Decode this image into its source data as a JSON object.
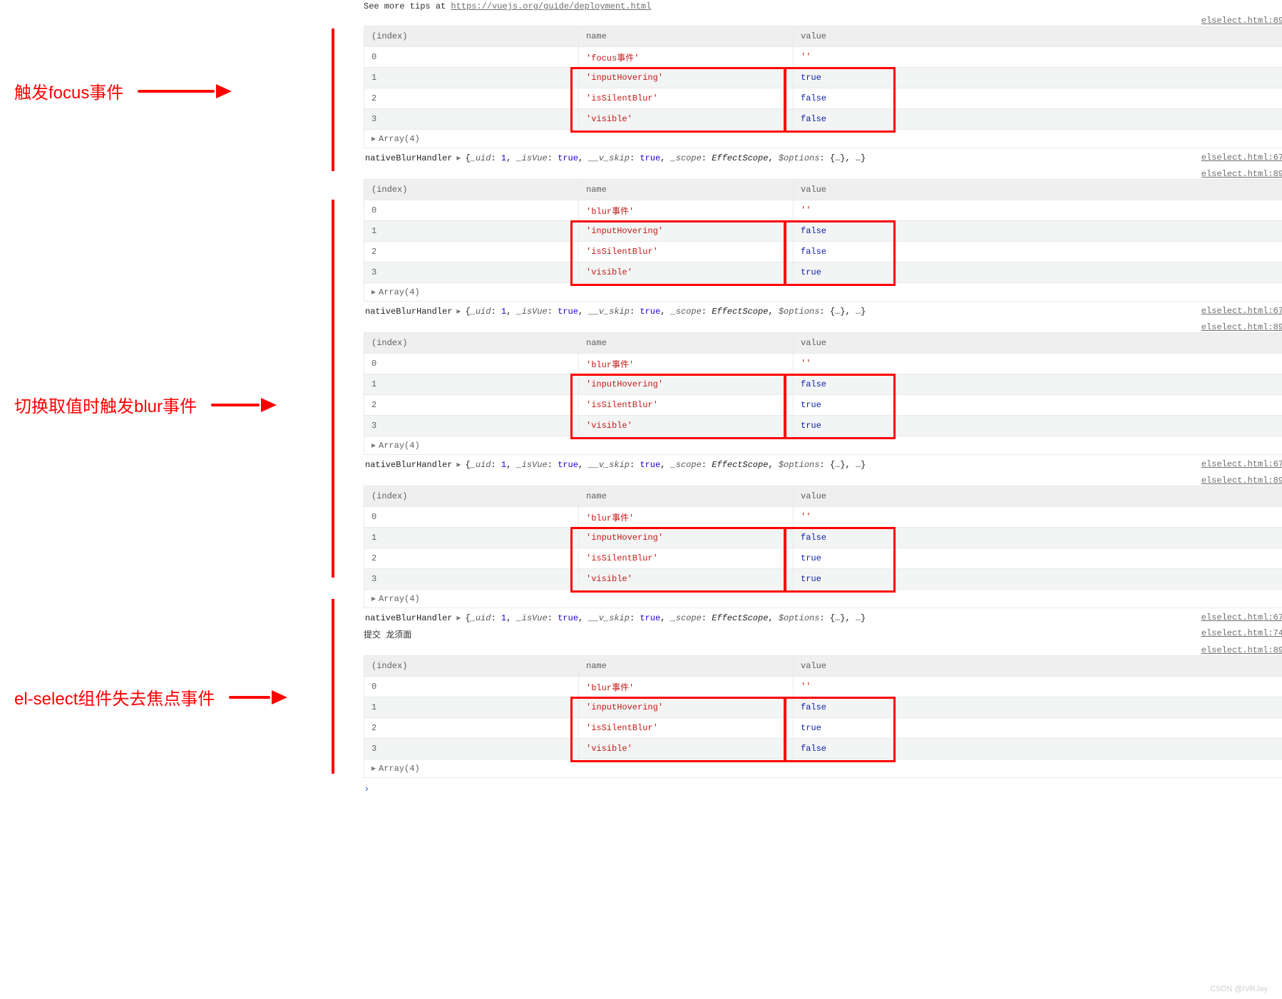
{
  "header": {
    "tip_line1": "",
    "tip_line2_prefix": "See more tips at ",
    "tip_link": "https://vuejs.org/guide/deployment.html"
  },
  "annotations": {
    "a1": "触发focus事件",
    "a2": "切换取值时触发blur事件",
    "a3": "el-select组件失去焦点事件"
  },
  "sources": {
    "t89": "elselect.html:89",
    "t67": "elselect.html:67",
    "t74": "elselect.html:74"
  },
  "headers": {
    "index": "(index)",
    "name": "name",
    "value": "value"
  },
  "array_summary": "Array(4)",
  "tri": "▸",
  "prompt": "›",
  "objline": {
    "fn": "nativeBlurHandler",
    "parts": [
      [
        "_uid",
        "1",
        "num"
      ],
      [
        "_isVue",
        "true",
        "bool"
      ],
      [
        "__v_skip",
        "true",
        "bool"
      ],
      [
        "_scope",
        "EffectScope",
        "cls"
      ],
      [
        "$options",
        "{…}",
        "plain"
      ],
      [
        "",
        "…",
        "plain"
      ]
    ]
  },
  "misc": {
    "submit_text": "提交 龙须面"
  },
  "tables": [
    {
      "rows": [
        {
          "i": "0",
          "name": "'focus事件'",
          "val": "''",
          "vtype": "str"
        },
        {
          "i": "1",
          "name": "'inputHovering'",
          "val": "true",
          "vtype": "bool"
        },
        {
          "i": "2",
          "name": "'isSilentBlur'",
          "val": "false",
          "vtype": "bool"
        },
        {
          "i": "3",
          "name": "'visible'",
          "val": "false",
          "vtype": "bool"
        }
      ]
    },
    {
      "rows": [
        {
          "i": "0",
          "name": "'blur事件'",
          "val": "''",
          "vtype": "str"
        },
        {
          "i": "1",
          "name": "'inputHovering'",
          "val": "false",
          "vtype": "bool"
        },
        {
          "i": "2",
          "name": "'isSilentBlur'",
          "val": "false",
          "vtype": "bool"
        },
        {
          "i": "3",
          "name": "'visible'",
          "val": "true",
          "vtype": "bool"
        }
      ]
    },
    {
      "rows": [
        {
          "i": "0",
          "name": "'blur事件'",
          "val": "''",
          "vtype": "str"
        },
        {
          "i": "1",
          "name": "'inputHovering'",
          "val": "false",
          "vtype": "bool"
        },
        {
          "i": "2",
          "name": "'isSilentBlur'",
          "val": "true",
          "vtype": "bool"
        },
        {
          "i": "3",
          "name": "'visible'",
          "val": "true",
          "vtype": "bool"
        }
      ]
    },
    {
      "rows": [
        {
          "i": "0",
          "name": "'blur事件'",
          "val": "''",
          "vtype": "str"
        },
        {
          "i": "1",
          "name": "'inputHovering'",
          "val": "false",
          "vtype": "bool"
        },
        {
          "i": "2",
          "name": "'isSilentBlur'",
          "val": "true",
          "vtype": "bool"
        },
        {
          "i": "3",
          "name": "'visible'",
          "val": "true",
          "vtype": "bool"
        }
      ]
    },
    {
      "rows": [
        {
          "i": "0",
          "name": "'blur事件'",
          "val": "''",
          "vtype": "str"
        },
        {
          "i": "1",
          "name": "'inputHovering'",
          "val": "false",
          "vtype": "bool"
        },
        {
          "i": "2",
          "name": "'isSilentBlur'",
          "val": "true",
          "vtype": "bool"
        },
        {
          "i": "3",
          "name": "'visible'",
          "val": "false",
          "vtype": "bool"
        }
      ]
    }
  ],
  "watermark": "CSDN @IVRJay"
}
